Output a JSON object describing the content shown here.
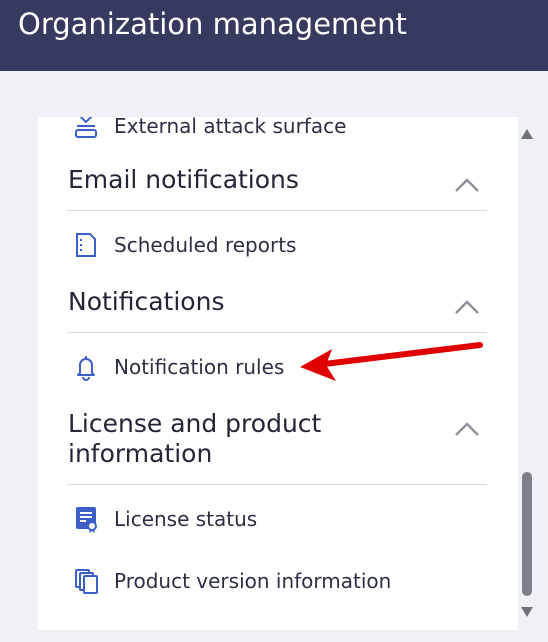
{
  "header": {
    "title": "Organization management"
  },
  "items": {
    "external_attack_surface": "External attack surface",
    "scheduled_reports": "Scheduled reports",
    "notification_rules": "Notification rules",
    "license_status": "License status",
    "product_version_information": "Product version information"
  },
  "sections": {
    "email_notifications": "Email notifications",
    "notifications": "Notifications",
    "license_and_product_information": "License and product information"
  },
  "colors": {
    "header_bg": "#353a5e",
    "icon_blue": "#3b5fc7",
    "annotation_arrow": "#e00000"
  }
}
